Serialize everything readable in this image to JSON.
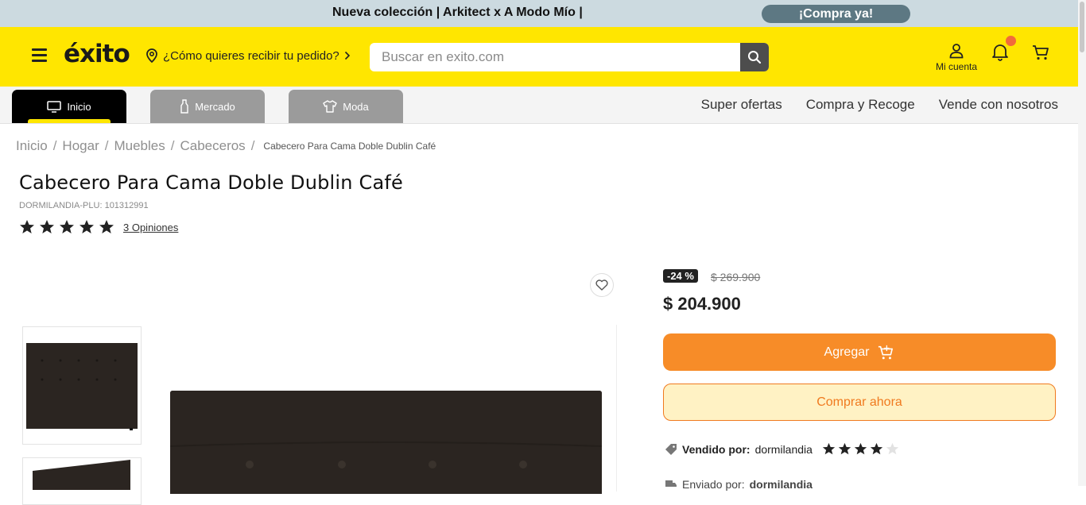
{
  "promo_bar": {
    "text": "Nueva colección | Arkitect x A Modo Mío |",
    "cta": "¡Compra ya!"
  },
  "header": {
    "logo": "éxito",
    "delivery_prompt": "¿Cómo quieres recibir tu pedido?",
    "search_placeholder": "Buscar en exito.com",
    "account_label": "Mi cuenta",
    "brand_color": "#ffe600"
  },
  "nav": {
    "tabs": [
      {
        "label": "Inicio",
        "icon": "tv-icon",
        "active": true
      },
      {
        "label": "Mercado",
        "icon": "bottle-icon",
        "active": false
      },
      {
        "label": "Moda",
        "icon": "shirt-icon",
        "active": false
      }
    ],
    "links": [
      "Super ofertas",
      "Compra y Recoge",
      "Vende con nosotros"
    ]
  },
  "breadcrumb": {
    "items": [
      "Inicio",
      "Hogar",
      "Muebles",
      "Cabeceros"
    ],
    "current": "Cabecero Para Cama Doble Dublin Café"
  },
  "product": {
    "title": "Cabecero Para Cama Doble Dublin Café",
    "plu": "DORMILANDIA-PLU: 101312991",
    "rating_stars": 5,
    "opinions": "3 Opiniones",
    "discount": "-24 %",
    "old_price": "$ 269.900",
    "price": "$ 204.900",
    "add_label": "Agregar",
    "buy_label": "Comprar ahora",
    "seller_prefix": "Vendido por:",
    "seller_name": "dormilandia",
    "seller_rating": 4,
    "shipping_prefix": "Enviado por:",
    "shipping_name": "dormilandia",
    "accent_color": "#f78c28"
  }
}
